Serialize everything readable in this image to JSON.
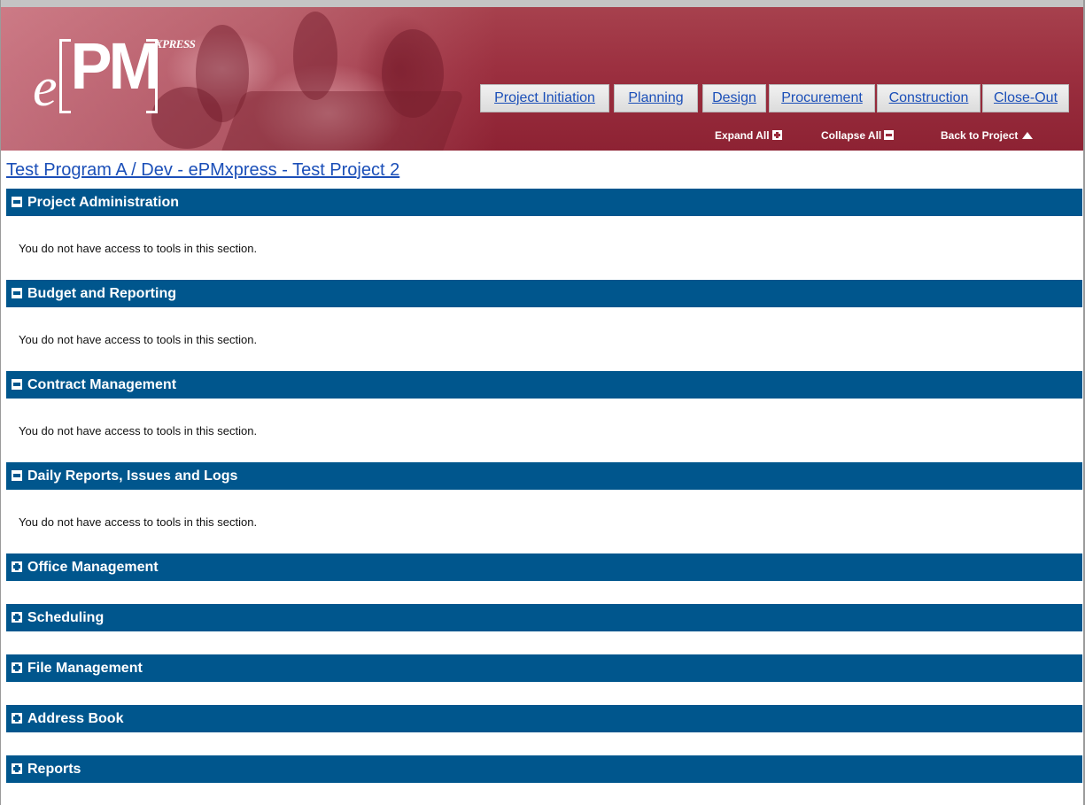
{
  "header": {
    "logo": {
      "e": "e",
      "pm": "PM",
      "xpress": "XPRESS"
    },
    "tabs": [
      {
        "label": "Project Initiation"
      },
      {
        "label": "Planning"
      },
      {
        "label": "Design"
      },
      {
        "label": "Procurement"
      },
      {
        "label": "Construction"
      },
      {
        "label": "Close-Out"
      }
    ],
    "expand_all": "Expand All",
    "collapse_all": "Collapse All",
    "back_to_project": "Back to Project"
  },
  "page_title": "Test Program A / Dev - ePMxpress - Test Project 2",
  "sections": [
    {
      "title": "Project Administration",
      "expanded": true,
      "message": "You do not have access to tools in this section."
    },
    {
      "title": "Budget and Reporting",
      "expanded": true,
      "message": "You do not have access to tools in this section."
    },
    {
      "title": "Contract Management",
      "expanded": true,
      "message": "You do not have access to tools in this section."
    },
    {
      "title": "Daily Reports, Issues and Logs",
      "expanded": true,
      "message": "You do not have access to tools in this section."
    },
    {
      "title": "Office Management",
      "expanded": false
    },
    {
      "title": "Scheduling",
      "expanded": false
    },
    {
      "title": "File Management",
      "expanded": false
    },
    {
      "title": "Address Book",
      "expanded": false
    },
    {
      "title": "Reports",
      "expanded": false
    }
  ],
  "colors": {
    "banner": "#9c3040",
    "section_bar": "#00568d",
    "link": "#1b4fb8"
  }
}
